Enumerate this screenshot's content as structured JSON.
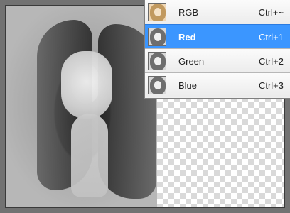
{
  "channels_panel": {
    "items": [
      {
        "name": "RGB",
        "shortcut": "Ctrl+~",
        "selected": false,
        "thumbnail": "rgb-thumbnail"
      },
      {
        "name": "Red",
        "shortcut": "Ctrl+1",
        "selected": true,
        "thumbnail": "grayscale-thumbnail"
      },
      {
        "name": "Green",
        "shortcut": "Ctrl+2",
        "selected": false,
        "thumbnail": "grayscale-thumbnail"
      },
      {
        "name": "Blue",
        "shortcut": "Ctrl+3",
        "selected": false,
        "thumbnail": "grayscale-thumbnail"
      }
    ],
    "colors": {
      "selection": "#3b96ff",
      "panel_bg": "#efefef"
    }
  },
  "canvas": {
    "content": "grayscale-photo",
    "transparent_area": "checkerboard"
  }
}
